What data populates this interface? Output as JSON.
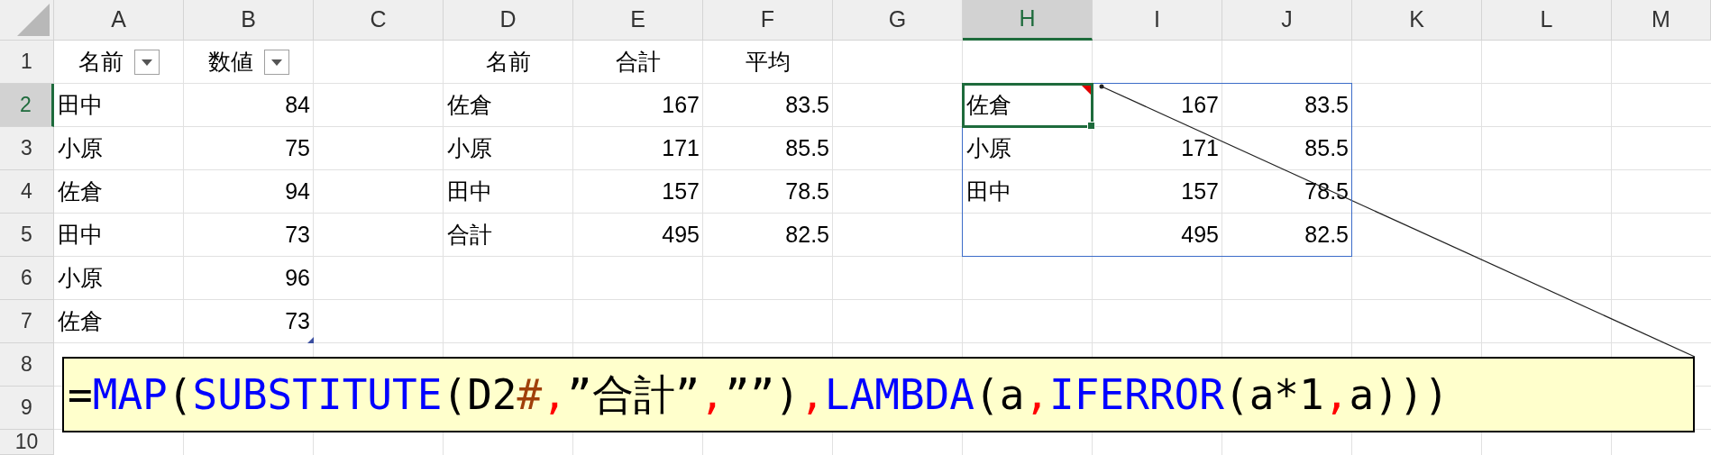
{
  "columns": [
    {
      "label": "A",
      "selected": false
    },
    {
      "label": "B",
      "selected": false
    },
    {
      "label": "C",
      "selected": false
    },
    {
      "label": "D",
      "selected": false
    },
    {
      "label": "E",
      "selected": false
    },
    {
      "label": "F",
      "selected": false
    },
    {
      "label": "G",
      "selected": false
    },
    {
      "label": "H",
      "selected": true
    },
    {
      "label": "I",
      "selected": false
    },
    {
      "label": "J",
      "selected": false
    },
    {
      "label": "K",
      "selected": false
    },
    {
      "label": "L",
      "selected": false
    },
    {
      "label": "M",
      "selected": false
    }
  ],
  "rows": [
    {
      "number": "1",
      "selected": false,
      "cells": {
        "A": {
          "text": "名前",
          "kind": "header",
          "filter": true
        },
        "B": {
          "text": "数値",
          "kind": "header",
          "filter": true
        },
        "D": {
          "text": "名前",
          "kind": "header"
        },
        "E": {
          "text": "合計",
          "kind": "header"
        },
        "F": {
          "text": "平均",
          "kind": "header"
        }
      }
    },
    {
      "number": "2",
      "selected": true,
      "cells": {
        "A": {
          "text": "田中",
          "kind": "text"
        },
        "B": {
          "text": "84",
          "kind": "number"
        },
        "D": {
          "text": "佐倉",
          "kind": "text"
        },
        "E": {
          "text": "167",
          "kind": "number"
        },
        "F": {
          "text": "83.5",
          "kind": "number"
        },
        "H": {
          "text": "佐倉",
          "kind": "text",
          "selected": true,
          "comment": true,
          "spill": true
        },
        "I": {
          "text": "167",
          "kind": "number"
        },
        "J": {
          "text": "83.5",
          "kind": "number"
        }
      }
    },
    {
      "number": "3",
      "selected": false,
      "cells": {
        "A": {
          "text": "小原",
          "kind": "text"
        },
        "B": {
          "text": "75",
          "kind": "number"
        },
        "D": {
          "text": "小原",
          "kind": "text"
        },
        "E": {
          "text": "171",
          "kind": "number"
        },
        "F": {
          "text": "85.5",
          "kind": "number"
        },
        "H": {
          "text": "小原",
          "kind": "text"
        },
        "I": {
          "text": "171",
          "kind": "number"
        },
        "J": {
          "text": "85.5",
          "kind": "number"
        }
      }
    },
    {
      "number": "4",
      "selected": false,
      "cells": {
        "A": {
          "text": "佐倉",
          "kind": "text"
        },
        "B": {
          "text": "94",
          "kind": "number"
        },
        "D": {
          "text": "田中",
          "kind": "text"
        },
        "E": {
          "text": "157",
          "kind": "number"
        },
        "F": {
          "text": "78.5",
          "kind": "number"
        },
        "H": {
          "text": "田中",
          "kind": "text"
        },
        "I": {
          "text": "157",
          "kind": "number"
        },
        "J": {
          "text": "78.5",
          "kind": "number"
        }
      }
    },
    {
      "number": "5",
      "selected": false,
      "cells": {
        "A": {
          "text": "田中",
          "kind": "text"
        },
        "B": {
          "text": "73",
          "kind": "number"
        },
        "D": {
          "text": "合計",
          "kind": "text"
        },
        "E": {
          "text": "495",
          "kind": "number"
        },
        "F": {
          "text": "82.5",
          "kind": "number"
        },
        "I": {
          "text": "495",
          "kind": "number"
        },
        "J": {
          "text": "82.5",
          "kind": "number"
        }
      }
    },
    {
      "number": "6",
      "selected": false,
      "cells": {
        "A": {
          "text": "小原",
          "kind": "text"
        },
        "B": {
          "text": "96",
          "kind": "number"
        }
      }
    },
    {
      "number": "7",
      "selected": false,
      "cells": {
        "A": {
          "text": "佐倉",
          "kind": "text"
        },
        "B": {
          "text": "73",
          "kind": "number",
          "table_end": true
        }
      }
    },
    {
      "number": "8",
      "selected": false,
      "cells": {}
    },
    {
      "number": "9",
      "selected": false,
      "cells": {}
    },
    {
      "number": "10",
      "selected": false,
      "cells": {}
    }
  ],
  "callout": {
    "tokens": [
      {
        "text": "=",
        "kind": "plain"
      },
      {
        "text": "MAP",
        "kind": "function"
      },
      {
        "text": "(",
        "kind": "plain"
      },
      {
        "text": "SUBSTITUTE",
        "kind": "function"
      },
      {
        "text": "(D2",
        "kind": "plain"
      },
      {
        "text": "#",
        "kind": "spill"
      },
      {
        "text": ",",
        "kind": "separator"
      },
      {
        "text": "”合計”",
        "kind": "plain"
      },
      {
        "text": ",",
        "kind": "separator"
      },
      {
        "text": "””)",
        "kind": "plain"
      },
      {
        "text": ",",
        "kind": "separator"
      },
      {
        "text": "LAMBDA",
        "kind": "function"
      },
      {
        "text": "(a",
        "kind": "plain"
      },
      {
        "text": ",",
        "kind": "separator"
      },
      {
        "text": "IFERROR",
        "kind": "function"
      },
      {
        "text": "(a*1",
        "kind": "plain"
      },
      {
        "text": ",",
        "kind": "separator"
      },
      {
        "text": "a)))",
        "kind": "plain"
      }
    ]
  }
}
